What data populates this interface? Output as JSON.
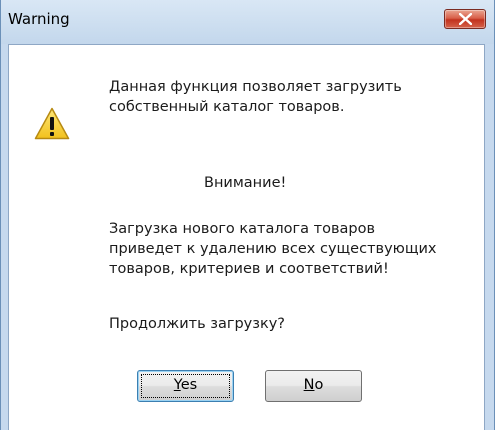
{
  "window": {
    "title": "Warning"
  },
  "icons": {
    "warning": "warning-triangle-icon",
    "close": "close-icon"
  },
  "message": {
    "intro_line1": "Данная функция позволяет загрузить",
    "intro_line2": "собственный каталог товаров.",
    "attention": "Внимание!",
    "warning_line1": "Загрузка нового каталога товаров",
    "warning_line2": "приведет к удалению всех существующих",
    "warning_line3": "товаров, критериев и соответствий!",
    "question": "Продолжить загрузку?"
  },
  "buttons": {
    "yes_mnemonic": "Y",
    "yes_rest": "es",
    "no_mnemonic": "N",
    "no_rest": "o"
  },
  "colors": {
    "title_bar": "#c6d9ee",
    "close_button": "#c2321e",
    "warning_icon": "#f5cf2c"
  }
}
